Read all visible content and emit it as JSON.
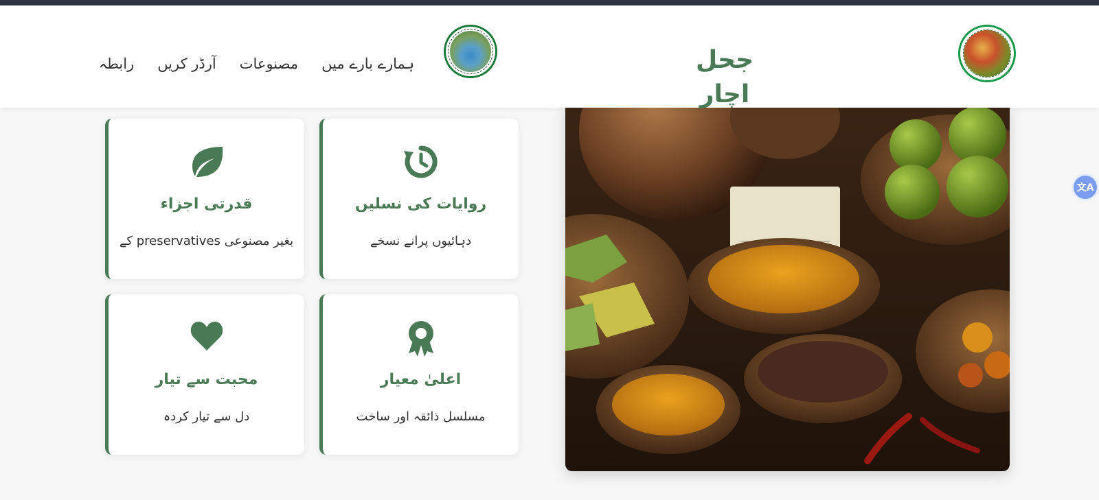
{
  "site": {
    "title": "جحل اچار"
  },
  "nav": {
    "items": [
      "ہمارے بارے میں",
      "مصنوعات",
      "آرڈر کریں",
      "رابطہ"
    ]
  },
  "features": [
    {
      "icon": "history-icon",
      "title": "روایات کی نسلیں",
      "desc": "دہائیوں پرانے نسخے"
    },
    {
      "icon": "leaf-icon",
      "title": "قدرتی اجزاء",
      "desc": "بغیر مصنوعی preservatives کے"
    },
    {
      "icon": "award-icon",
      "title": "اعلیٰ معیار",
      "desc": "مسلسل ذائقہ اور ساخت"
    },
    {
      "icon": "heart-icon",
      "title": "محبت سے تیار",
      "desc": "دل سے تیار کردہ"
    }
  ],
  "colors": {
    "accent": "#4a7a55",
    "topbar": "#2f3542",
    "logo_ring": "#1a9a4a"
  }
}
